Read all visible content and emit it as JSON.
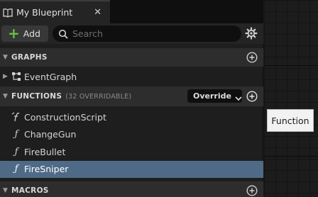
{
  "tab": {
    "title": "My Blueprint",
    "icon": "book-icon",
    "close_glyph": "✕"
  },
  "toolbar": {
    "add_label": "Add",
    "search_placeholder": "Search"
  },
  "sections": {
    "graphs": {
      "title": "GRAPHS"
    },
    "functions": {
      "title": "FUNCTIONS",
      "subtitle": "(32 OVERRIDABLE)",
      "override_label": "Override"
    },
    "macros": {
      "title": "MACROS"
    }
  },
  "graphs_items": [
    {
      "label": "EventGraph",
      "icon": "event-graph-icon"
    }
  ],
  "function_items": [
    {
      "label": "ConstructionScript",
      "icon": "construction-function-icon"
    },
    {
      "label": "ChangeGun",
      "icon": "function-icon"
    },
    {
      "label": "FireBullet",
      "icon": "function-icon"
    },
    {
      "label": "FireSniper",
      "icon": "function-icon",
      "selected": true
    }
  ],
  "tooltip": {
    "text": "Function"
  },
  "colors": {
    "accent_green": "#6cbf3e",
    "selected_row": "#4f6a86",
    "panel_bg": "#1e1e1e"
  }
}
